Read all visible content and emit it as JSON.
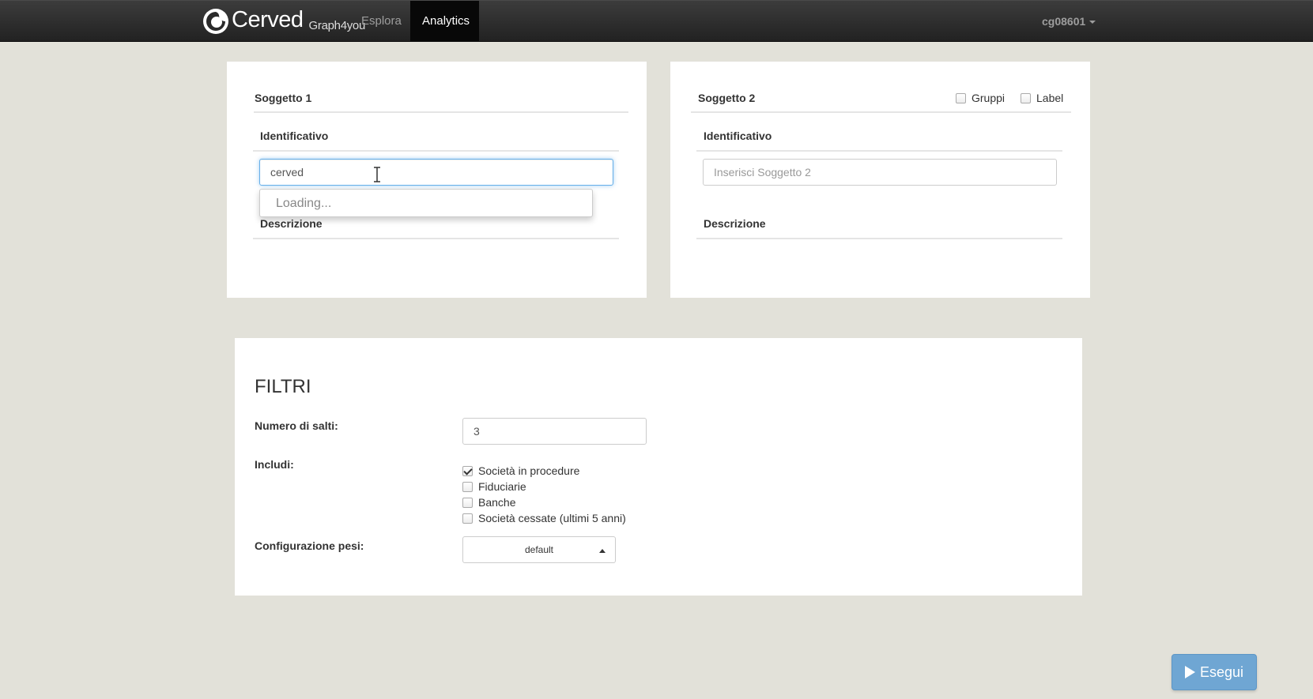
{
  "navbar": {
    "brand_name": "Cerved",
    "brand_sub": "Graph4you",
    "links": [
      {
        "label": "Esplora",
        "active": false
      },
      {
        "label": "Analytics",
        "active": true
      }
    ],
    "user": "cg08601",
    "icons": {
      "logo": "cerved-logo-icon",
      "user_caret": "caret-down-icon"
    }
  },
  "subject1": {
    "title": "Soggetto 1",
    "id_label": "Identificativo",
    "input_value": "cerved",
    "dropdown_text": "Loading...",
    "desc_label": "Descrizione"
  },
  "subject2": {
    "title": "Soggetto 2",
    "options": [
      {
        "label": "Gruppi",
        "checked": false
      },
      {
        "label": "Label",
        "checked": false
      }
    ],
    "id_label": "Identificativo",
    "input_placeholder": "Inserisci Soggetto 2",
    "desc_label": "Descrizione"
  },
  "filters": {
    "title": "FILTRI",
    "hops_label": "Numero di salti:",
    "hops_value": "3",
    "include_label": "Includi:",
    "include_options": [
      {
        "label": "Società in procedure",
        "checked": true
      },
      {
        "label": "Fiduciarie",
        "checked": false
      },
      {
        "label": "Banche",
        "checked": false
      },
      {
        "label": "Società cessate (ultimi 5 anni)",
        "checked": false
      }
    ],
    "weights_label": "Configurazione pesi:",
    "weights_value": "default"
  },
  "run_button": {
    "label": "Esegui",
    "icon": "play-icon"
  },
  "colors": {
    "background": "#e2e1d9",
    "navbar": "#222222",
    "focus": "#66afe9",
    "run_button": "#6fa6d3"
  }
}
